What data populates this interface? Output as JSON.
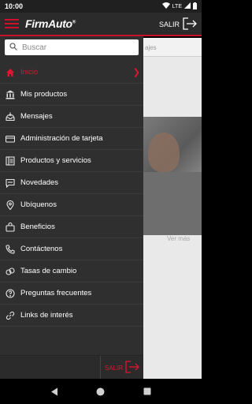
{
  "status": {
    "time": "10:00",
    "network": "LTE"
  },
  "header": {
    "logo": "FirmAuto",
    "exit_label": "SALIR"
  },
  "background": {
    "tab_fragment": "ajes",
    "more_link": "Ver más"
  },
  "search": {
    "placeholder": "Buscar"
  },
  "menu": [
    {
      "label": "Inicio",
      "icon": "home-icon",
      "active": true
    },
    {
      "label": "Mis productos",
      "icon": "bank-icon"
    },
    {
      "label": "Mensajes",
      "icon": "inbox-icon"
    },
    {
      "label": "Administración de tarjeta",
      "icon": "card-icon"
    },
    {
      "label": "Productos y servicios",
      "icon": "catalog-icon"
    },
    {
      "label": "Novedades",
      "icon": "chat-icon"
    },
    {
      "label": "Ubíquenos",
      "icon": "location-pin-icon"
    },
    {
      "label": "Beneficios",
      "icon": "bag-icon"
    },
    {
      "label": "Contáctenos",
      "icon": "phone-icon"
    },
    {
      "label": "Tasas de cambio",
      "icon": "exchange-icon"
    },
    {
      "label": "Preguntas frecuentes",
      "icon": "help-icon"
    },
    {
      "label": "Links de interés",
      "icon": "link-icon"
    }
  ],
  "footer": {
    "exit_label": "SALIR"
  },
  "colors": {
    "accent": "#e0152f",
    "drawer": "#2f2f2f",
    "header": "#2b2b2b"
  }
}
